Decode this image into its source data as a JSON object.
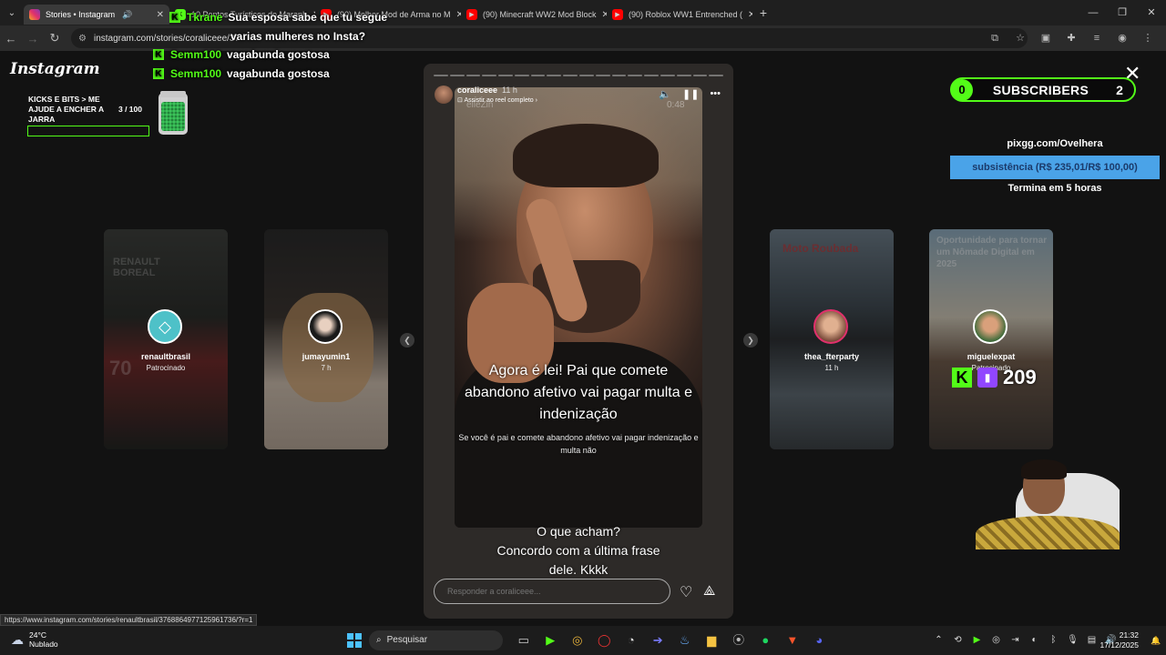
{
  "browser": {
    "tabs": [
      {
        "title": "Stories • Instagram",
        "active": true,
        "favicon": "instagram-icon",
        "audio": true
      },
      {
        "title": "10 Pontos Turísticos do Maranh",
        "active": false,
        "favicon": "kick-icon"
      },
      {
        "title": "(90) Melhor Mod de Arma no M",
        "active": false,
        "favicon": "youtube-icon"
      },
      {
        "title": "(90) Minecraft WW2 Mod Block",
        "active": false,
        "favicon": "youtube-icon"
      },
      {
        "title": "(90) Roblox WW1 Entrenched (",
        "active": false,
        "favicon": "youtube-icon"
      }
    ],
    "url": "instagram.com/stories/coraliceee/37",
    "status_url": "https://www.instagram.com/stories/renaultbrasil/3768864977125961736/?r=1"
  },
  "chat": [
    {
      "user": "Tkrane",
      "message": "Sua esposa sabe que tu segue varias mulheres no Insta?",
      "line1": "Sua esposa sabe que tu segue",
      "line2": "varias mulheres no Insta?"
    },
    {
      "user": "Semm100",
      "message": "vagabunda gostosa"
    },
    {
      "user": "Semm100",
      "message": "vagabunda gostosa"
    }
  ],
  "instagram": {
    "logo": "Instagram",
    "side_stories_left": [
      {
        "user": "renaultbrasil",
        "sub": "Patrocinado",
        "bg_text": "RENAULT BOREAL"
      },
      {
        "user": "jumayumin1",
        "sub": "7 h"
      }
    ],
    "side_stories_right": [
      {
        "user": "thea_fterparty",
        "sub": "11 h",
        "bg_text": "Moto Roubada"
      },
      {
        "user": "miguelexpat",
        "sub": "Patrocinado",
        "bg_text": "Oportunidade para tornar um Nômade Digital em 2025"
      }
    ],
    "story": {
      "author": "coraliceee",
      "time": "11 h",
      "reel_link": "Assistir ao reel completo",
      "timestamp": "0:48",
      "watermark": "elleZin",
      "caption_main": "Agora é lei! Pai que comete abandono afetivo vai pagar multa e indenização",
      "caption_sub": "Se você é pai e comete abandono afetivo vai pagar indenização e multa não",
      "caption_bottom_1": "O que acham?",
      "caption_bottom_2": "Concordo com a última frase",
      "caption_bottom_3": "dele. Kkkk",
      "reply_placeholder": "Responder a coraliceee...",
      "progress_segments": 18,
      "progress_done": 0
    }
  },
  "overlays": {
    "kicks_title": "KICKS E BITS > ME AJUDE A ENCHER A JARRA",
    "kicks_count": "3  / 100",
    "subs_current": "0",
    "subs_label": "SUBSCRIBERS",
    "subs_goal": "2",
    "pix_url": "pixgg.com/Ovelhera",
    "pix_goal": "subsistência (R$ 235,01/R$ 100,00)",
    "pix_time": "Termina em 5 horas",
    "viewers": "209"
  },
  "taskbar": {
    "weather_temp": "24°C",
    "weather_desc": "Nublado",
    "search": "Pesquisar",
    "time": "21:32",
    "date": "17/12/2025"
  },
  "colors": {
    "kick_green": "#53fc18",
    "pix_blue": "#4aa3e8",
    "twitch_purple": "#9146ff"
  }
}
